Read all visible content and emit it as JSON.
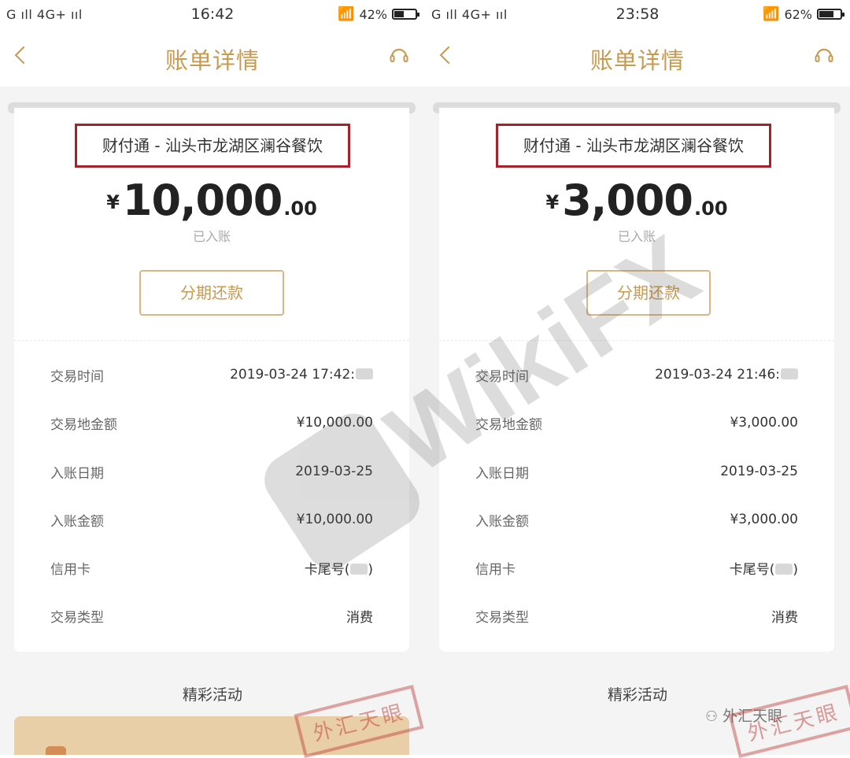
{
  "panels": [
    {
      "status": {
        "network": "G ıll 4G+ ııl",
        "time": "16:42",
        "battery": "42%",
        "battery_level": 0.42
      },
      "nav": {
        "title": "账单详情"
      },
      "merchant": "财付通 - 汕头市龙湖区澜谷餐饮",
      "amount": {
        "currency": "¥",
        "integer": "10,000",
        "decimal": ".00"
      },
      "status_text": "已入账",
      "installment_button": "分期还款",
      "details": [
        {
          "label": "交易时间",
          "value": "2019-03-24 17:42:",
          "masked": true
        },
        {
          "label": "交易地金额",
          "value": "¥10,000.00"
        },
        {
          "label": "入账日期",
          "value": "2019-03-25"
        },
        {
          "label": "入账金额",
          "value": "¥10,000.00"
        },
        {
          "label": "信用卡",
          "value": "卡尾号(",
          "masked_card": true,
          "suffix": ")"
        },
        {
          "label": "交易类型",
          "value": "消费"
        }
      ],
      "section_title": "精彩活动"
    },
    {
      "status": {
        "network": "G ıll 4G+ ııl",
        "time": "23:58",
        "battery": "62%",
        "battery_level": 0.62
      },
      "nav": {
        "title": "账单详情"
      },
      "merchant": "财付通 - 汕头市龙湖区澜谷餐饮",
      "amount": {
        "currency": "¥",
        "integer": "3,000",
        "decimal": ".00"
      },
      "status_text": "已入账",
      "installment_button": "分期还款",
      "details": [
        {
          "label": "交易时间",
          "value": "2019-03-24 21:46:",
          "masked": true
        },
        {
          "label": "交易地金额",
          "value": "¥3,000.00"
        },
        {
          "label": "入账日期",
          "value": "2019-03-25"
        },
        {
          "label": "入账金额",
          "value": "¥3,000.00"
        },
        {
          "label": "信用卡",
          "value": "卡尾号(",
          "masked_card": true,
          "suffix": ")"
        },
        {
          "label": "交易类型",
          "value": "消费"
        }
      ],
      "section_title": "精彩活动"
    }
  ],
  "overlay": {
    "watermark": "WikiFX",
    "stamp": "外汇天眼",
    "wechat_credit": "外汇天眼"
  },
  "colors": {
    "accent": "#c89a4f",
    "highlight_border": "#a5222c"
  },
  "icons": {
    "back": "chevron-left-icon",
    "service": "headset-icon",
    "wifi": "wifi-icon",
    "battery": "battery-icon"
  }
}
